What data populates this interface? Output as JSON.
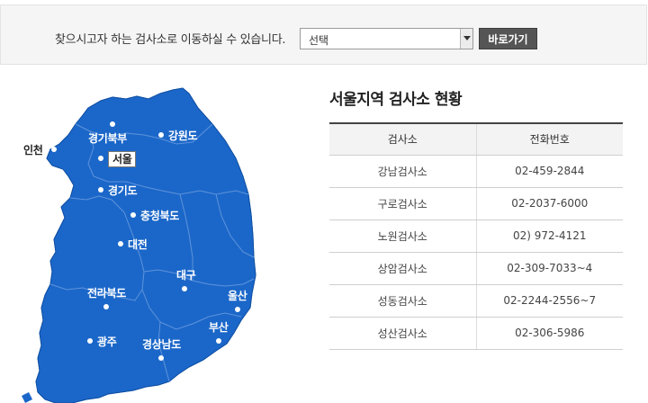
{
  "topbar": {
    "label": "찾으시고자 하는 검사소로 이동하실 수 있습니다.",
    "select": {
      "value": "선택"
    },
    "go_button": "바로가기"
  },
  "map": {
    "fill_color": "#1b67c9",
    "cities": [
      {
        "key": "incheon",
        "name": "인천"
      },
      {
        "key": "gyeonggi-north",
        "name": "경기북부"
      },
      {
        "key": "gangwon",
        "name": "강원도"
      },
      {
        "key": "seoul",
        "name": "서울",
        "selected": true
      },
      {
        "key": "gyeonggi",
        "name": "경기도"
      },
      {
        "key": "chungbuk",
        "name": "충청북도"
      },
      {
        "key": "daejeon",
        "name": "대전"
      },
      {
        "key": "daegu",
        "name": "대구"
      },
      {
        "key": "jeonbuk",
        "name": "전라북도"
      },
      {
        "key": "ulsan",
        "name": "울산"
      },
      {
        "key": "busan",
        "name": "부산"
      },
      {
        "key": "gwangju",
        "name": "광주"
      },
      {
        "key": "gyeongnam",
        "name": "경상남도"
      }
    ]
  },
  "panel": {
    "title": "서울지역 검사소 현황",
    "columns": [
      "검사소",
      "전화번호"
    ],
    "rows": [
      [
        "강남검사소",
        "02-459-2844"
      ],
      [
        "구로검사소",
        "02-2037-6000"
      ],
      [
        "노원검사소",
        "02) 972-4121"
      ],
      [
        "상암검사소",
        "02-309-7033~4"
      ],
      [
        "성동검사소",
        "02-2244-2556~7"
      ],
      [
        "성산검사소",
        "02-306-5986"
      ]
    ]
  }
}
